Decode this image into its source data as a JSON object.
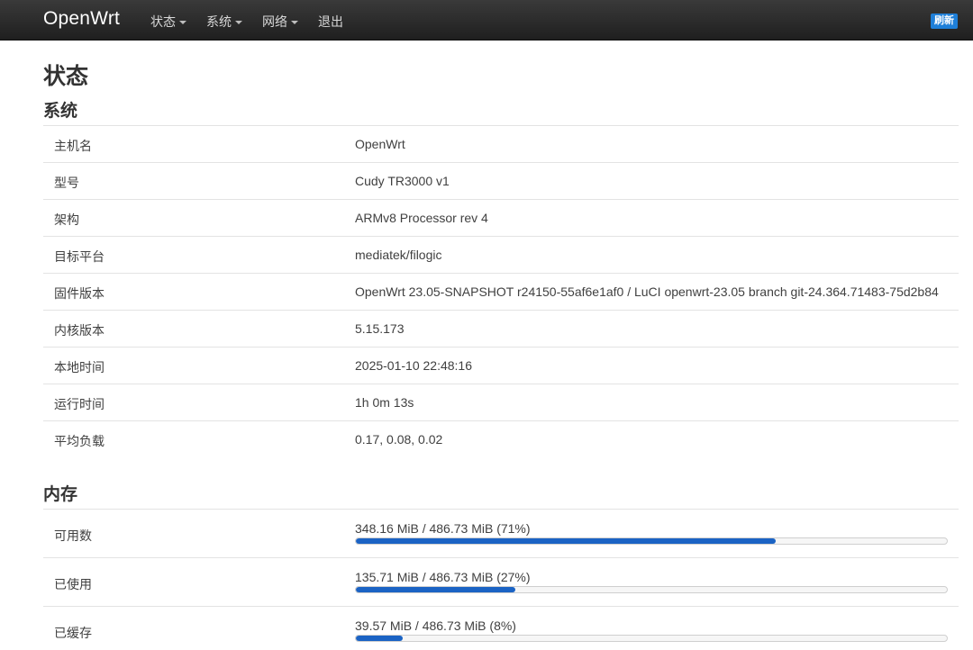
{
  "header": {
    "brand": "OpenWrt",
    "menu": [
      {
        "label": "状态",
        "dropdown": true
      },
      {
        "label": "系统",
        "dropdown": true
      },
      {
        "label": "网络",
        "dropdown": true
      },
      {
        "label": "退出",
        "dropdown": false
      }
    ],
    "refresh_label": "刷新"
  },
  "page_title": "状态",
  "system": {
    "title": "系统",
    "rows": [
      {
        "label": "主机名",
        "value": "OpenWrt"
      },
      {
        "label": "型号",
        "value": "Cudy TR3000 v1"
      },
      {
        "label": "架构",
        "value": "ARMv8 Processor rev 4"
      },
      {
        "label": "目标平台",
        "value": "mediatek/filogic"
      },
      {
        "label": "固件版本",
        "value": "OpenWrt 23.05-SNAPSHOT r24150-55af6e1af0 / LuCI openwrt-23.05 branch git-24.364.71483-75d2b84"
      },
      {
        "label": "内核版本",
        "value": "5.15.173"
      },
      {
        "label": "本地时间",
        "value": "2025-01-10 22:48:16"
      },
      {
        "label": "运行时间",
        "value": "1h 0m 13s"
      },
      {
        "label": "平均负载",
        "value": "0.17, 0.08, 0.02"
      }
    ]
  },
  "memory": {
    "title": "内存",
    "rows": [
      {
        "label": "可用数",
        "value": "348.16 MiB / 486.73 MiB (71%)",
        "percent": 71
      },
      {
        "label": "已使用",
        "value": "135.71 MiB / 486.73 MiB (27%)",
        "percent": 27
      },
      {
        "label": "已缓存",
        "value": "39.57 MiB / 486.73 MiB (8%)",
        "percent": 8
      }
    ]
  },
  "colors": {
    "navbar": "#2b2b2b",
    "accent": "#1b63c4",
    "refresh": "#1e7fd8"
  }
}
